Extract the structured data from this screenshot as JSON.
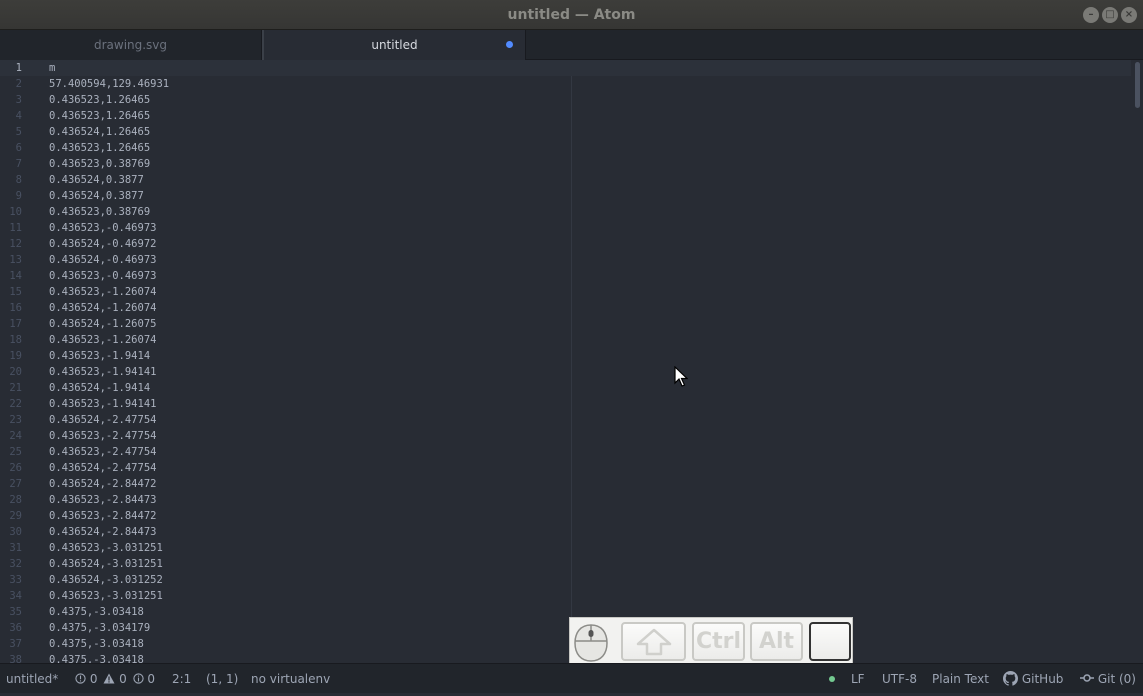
{
  "window": {
    "title": "untitled — Atom",
    "buttons": [
      "–",
      "□",
      "×"
    ]
  },
  "tabs": [
    {
      "label": "drawing.svg",
      "active": false,
      "modified": false
    },
    {
      "label": "untitled",
      "active": true,
      "modified": true
    }
  ],
  "editor": {
    "lines": [
      "m",
      "57.400594,129.46931",
      "0.436523,1.26465",
      "0.436523,1.26465",
      "0.436524,1.26465",
      "0.436523,1.26465",
      "0.436523,0.38769",
      "0.436524,0.3877",
      "0.436524,0.3877",
      "0.436523,0.38769",
      "0.436523,-0.46973",
      "0.436524,-0.46972",
      "0.436524,-0.46973",
      "0.436523,-0.46973",
      "0.436523,-1.26074",
      "0.436524,-1.26074",
      "0.436524,-1.26075",
      "0.436523,-1.26074",
      "0.436523,-1.9414",
      "0.436523,-1.94141",
      "0.436524,-1.9414",
      "0.436523,-1.94141",
      "0.436524,-2.47754",
      "0.436523,-2.47754",
      "0.436523,-2.47754",
      "0.436524,-2.47754",
      "0.436524,-2.84472",
      "0.436523,-2.84473",
      "0.436523,-2.84472",
      "0.436524,-2.84473",
      "0.436523,-3.031251",
      "0.436524,-3.031251",
      "0.436524,-3.031252",
      "0.436523,-3.031251",
      "0.4375,-3.03418",
      "0.4375,-3.034179",
      "0.4375,-3.03418",
      "0.4375,-3.03418"
    ]
  },
  "statusbar": {
    "file": "untitled*",
    "errors": "0",
    "warnings": "0",
    "infos": "0",
    "selection": "2:1",
    "cursor": "(1, 1)",
    "virtualenv": "no virtualenv",
    "line_ending": "LF",
    "encoding": "UTF-8",
    "grammar": "Plain Text",
    "github": "GitHub",
    "git": "Git (0)"
  },
  "key_overlay": {
    "keys": [
      "Ctrl",
      "Alt"
    ]
  },
  "colors": {
    "accent": "#528bff",
    "ok": "#73c990"
  }
}
